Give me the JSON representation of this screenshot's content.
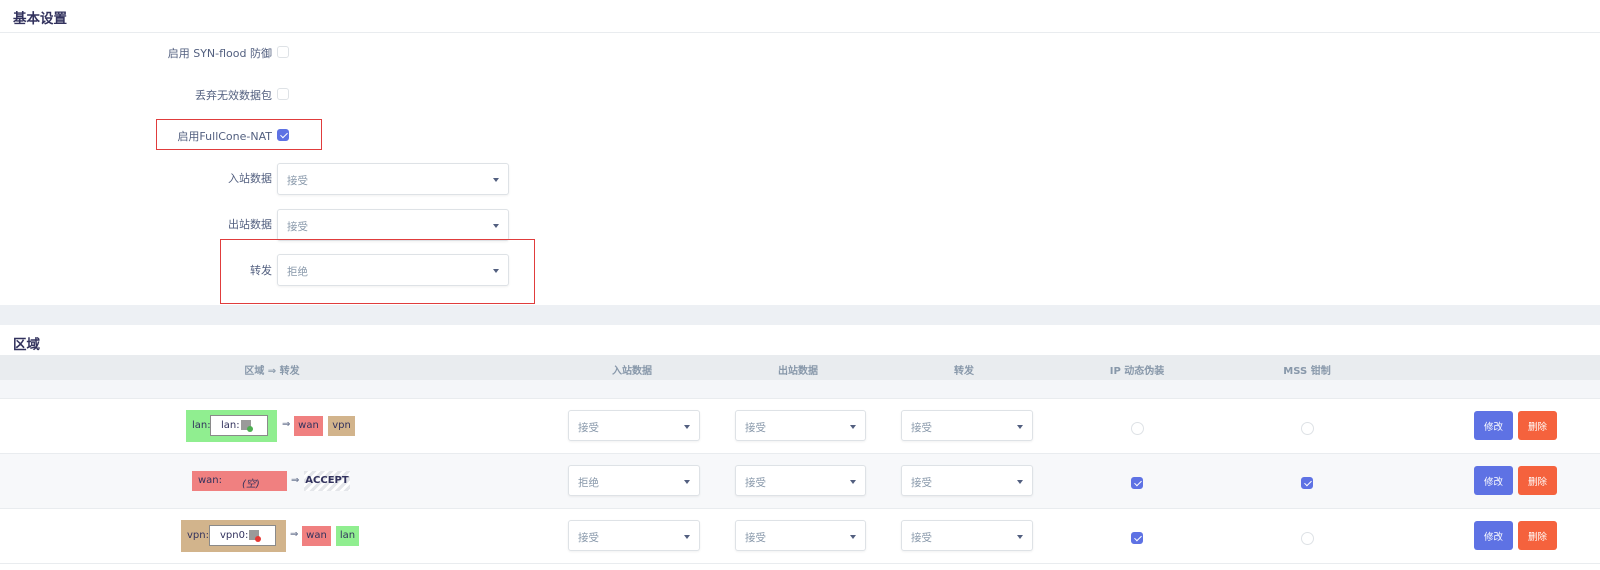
{
  "basic": {
    "title": "基本设置",
    "syn_flood_label": "启用 SYN-flood 防御",
    "drop_invalid_label": "丢弃无效数据包",
    "fullcone_label": "启用FullCone-NAT",
    "input_label": "入站数据",
    "input_value": "接受",
    "output_label": "出站数据",
    "output_value": "接受",
    "forward_label": "转发",
    "forward_value": "拒绝"
  },
  "zones": {
    "title": "区域",
    "headers": {
      "zone_forward": "区域 ⇒ 转发",
      "input": "入站数据",
      "output": "出站数据",
      "forward": "转发",
      "masq": "IP 动态伪装",
      "mss": "MSS 钳制"
    },
    "rows": [
      {
        "zone": "lan:",
        "iface": "lan:",
        "targets": [
          "wan",
          "vpn"
        ],
        "input": "接受",
        "output": "接受",
        "forward": "接受",
        "masq": false,
        "mss": false
      },
      {
        "zone": "wan:",
        "empty": "(空)",
        "targets": [
          "ACCEPT"
        ],
        "input": "拒绝",
        "output": "接受",
        "forward": "接受",
        "masq": true,
        "mss": true
      },
      {
        "zone": "vpn:",
        "iface": "vpn0:",
        "targets": [
          "wan",
          "lan"
        ],
        "input": "接受",
        "output": "接受",
        "forward": "接受",
        "masq": true,
        "mss": false
      }
    ],
    "arrow": "⇒",
    "edit_label": "修改",
    "delete_label": "删除"
  },
  "colors": {
    "accent": "#5e72e4",
    "danger": "#f5623d",
    "zone_lan": "#90ee90",
    "zone_wan": "#f08080",
    "zone_vpn": "#d2b48c",
    "highlight": "#e03c3c"
  },
  "icons": {
    "checkbox": "check-icon",
    "select_caret": "caret-down-icon",
    "iface_green": "network-interface-up-icon",
    "iface_red": "network-interface-down-icon"
  }
}
